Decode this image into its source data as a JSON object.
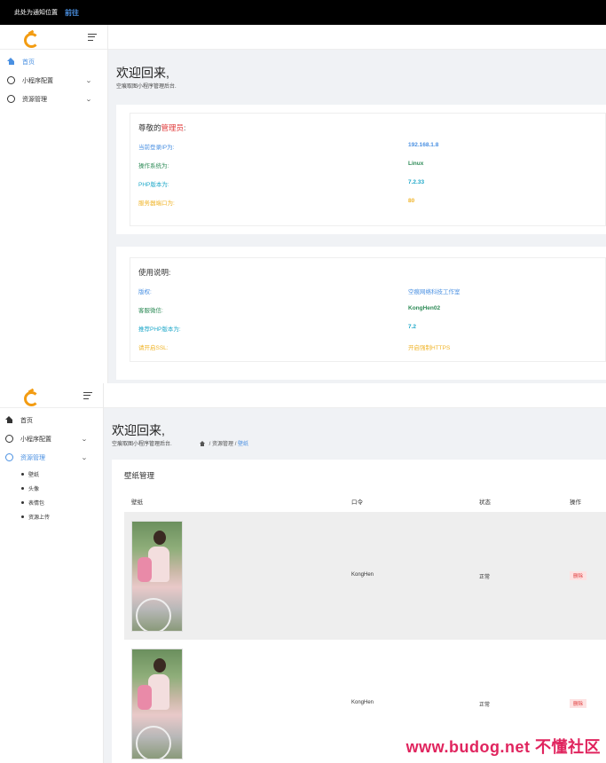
{
  "topbar": {
    "notice": "此处为通知位置",
    "go_label": "前往"
  },
  "sidebar": {
    "items": [
      {
        "label": "首页"
      },
      {
        "label": "小程序配置"
      },
      {
        "label": "资源管理"
      }
    ],
    "subitems": [
      {
        "label": "壁纸"
      },
      {
        "label": "头像"
      },
      {
        "label": "表情包"
      },
      {
        "label": "资源上传"
      }
    ]
  },
  "welcome": {
    "title": "欢迎回来,",
    "subtitle": "空痕取图小程序管理后台."
  },
  "admin_card": {
    "title_prefix": "尊敬的",
    "title_highlight": "管理员",
    "title_suffix": ":",
    "rows": [
      {
        "label": "当前登录IP为:",
        "value": "192.168.1.8"
      },
      {
        "label": "操作系统为:",
        "value": "Linux"
      },
      {
        "label": "PHP版本为:",
        "value": "7.2.33"
      },
      {
        "label": "服务器端口为:",
        "value": "80"
      }
    ]
  },
  "usage_card": {
    "title": "使用说明:",
    "rows": [
      {
        "label": "版权:",
        "value": "空痕网络科技工作室"
      },
      {
        "label": "客服微信:",
        "value": "KongHen02"
      },
      {
        "label": "推荐PHP版本为:",
        "value": "7.2"
      },
      {
        "label": "请开启SSL:",
        "value": "开启强制HTTPS"
      }
    ]
  },
  "breadcrumb": {
    "section": "资源管理",
    "current": "壁纸",
    "sep": "/"
  },
  "wallpaper": {
    "title": "壁纸管理",
    "columns": [
      "壁纸",
      "口令",
      "状态",
      "操作"
    ],
    "rows": [
      {
        "code": "KongHen",
        "status": "正常",
        "action": "删除"
      },
      {
        "code": "KongHen",
        "status": "正常",
        "action": "删除"
      }
    ]
  },
  "watermark": "www.budog.net 不懂社区",
  "colors": {
    "accent": "#4a90e2",
    "danger": "#e03a3a",
    "green": "#2e8b57",
    "cyan": "#1fa8c9",
    "orange": "#f0b429"
  }
}
